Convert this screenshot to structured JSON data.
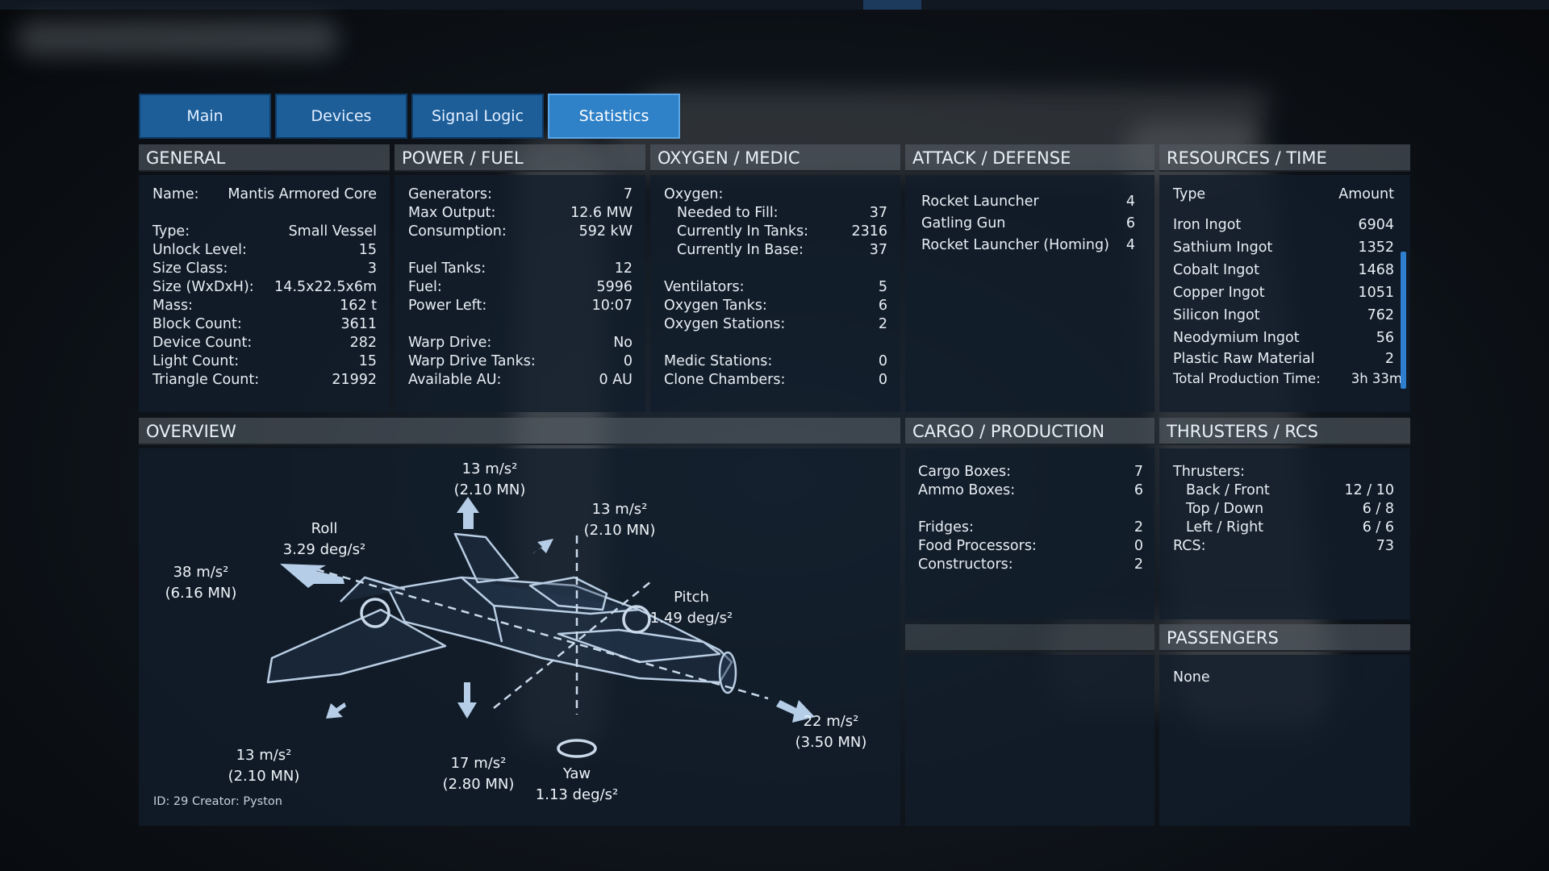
{
  "tabs": [
    {
      "label": "Main"
    },
    {
      "label": "Devices"
    },
    {
      "label": "Signal Logic"
    },
    {
      "label": "Statistics",
      "active": true
    }
  ],
  "general": {
    "title": "GENERAL",
    "rows": [
      {
        "k": "Name:",
        "v": "Mantis Armored Core"
      },
      {
        "k": "Type:",
        "v": "Small Vessel"
      },
      {
        "k": "Unlock Level:",
        "v": "15"
      },
      {
        "k": "Size Class:",
        "v": "3"
      },
      {
        "k": "Size (WxDxH):",
        "v": "14.5x22.5x6m"
      },
      {
        "k": "Mass:",
        "v": "162 t"
      },
      {
        "k": "Block Count:",
        "v": "3611"
      },
      {
        "k": "Device Count:",
        "v": "282"
      },
      {
        "k": "Light Count:",
        "v": "15"
      },
      {
        "k": "Triangle Count:",
        "v": "21992"
      }
    ]
  },
  "power": {
    "title": "POWER / FUEL",
    "rows": [
      {
        "k": "Generators:",
        "v": "7"
      },
      {
        "k": "Max Output:",
        "v": "12.6 MW"
      },
      {
        "k": "Consumption:",
        "v": "592 kW"
      },
      {
        "k": "Fuel Tanks:",
        "v": "12"
      },
      {
        "k": "Fuel:",
        "v": "5996"
      },
      {
        "k": "Power Left:",
        "v": "10:07"
      },
      {
        "k": "Warp Drive:",
        "v": "No"
      },
      {
        "k": "Warp Drive Tanks:",
        "v": "0"
      },
      {
        "k": "Available AU:",
        "v": "0 AU"
      }
    ]
  },
  "oxygen": {
    "title": "OXYGEN / MEDIC",
    "rows": [
      {
        "k": "Oxygen:",
        "v": ""
      },
      {
        "k": "Needed to Fill:",
        "v": "37"
      },
      {
        "k": "Currently In Tanks:",
        "v": "2316"
      },
      {
        "k": "Currently In Base:",
        "v": "37"
      },
      {
        "k": "Ventilators:",
        "v": "5"
      },
      {
        "k": "Oxygen Tanks:",
        "v": "6"
      },
      {
        "k": "Oxygen Stations:",
        "v": "2"
      },
      {
        "k": "Medic Stations:",
        "v": "0"
      },
      {
        "k": "Clone Chambers:",
        "v": "0"
      }
    ]
  },
  "attack": {
    "title": "ATTACK / DEFENSE",
    "rows": [
      {
        "k": "Rocket Launcher",
        "v": "4"
      },
      {
        "k": "Gatling Gun",
        "v": "6"
      },
      {
        "k": "Rocket Launcher (Homing)",
        "v": "4"
      }
    ]
  },
  "resources": {
    "title": "RESOURCES / TIME",
    "col_type": "Type",
    "col_amount": "Amount",
    "rows": [
      {
        "k": "Iron Ingot",
        "v": "6904"
      },
      {
        "k": "Sathium Ingot",
        "v": "1352"
      },
      {
        "k": "Cobalt Ingot",
        "v": "1468"
      },
      {
        "k": "Copper Ingot",
        "v": "1051"
      },
      {
        "k": "Silicon Ingot",
        "v": "762"
      },
      {
        "k": "Neodymium Ingot",
        "v": "56"
      },
      {
        "k": "Plastic Raw Material",
        "v": "2"
      }
    ],
    "total_label": "Total Production Time:",
    "total_value": "3h 33m"
  },
  "overview": {
    "title": "OVERVIEW",
    "id_creator": "ID: 29  Creator: Pyston",
    "labels": {
      "up": "13 m/s²\n(2.10 MN)",
      "fwd_up": "13 m/s²\n(2.10 MN)",
      "roll": "Roll\n3.29 deg/s²",
      "back": "38 m/s²\n(6.16 MN)",
      "pitch": "Pitch\n1.49 deg/s²",
      "forward": "22 m/s²\n(3.50 MN)",
      "left_down": "13 m/s²\n(2.10 MN)",
      "down": "17 m/s²\n(2.80 MN)",
      "yaw": "Yaw\n1.13 deg/s²"
    }
  },
  "cargo": {
    "title": "CARGO / PRODUCTION",
    "rows": [
      {
        "k": "Cargo Boxes:",
        "v": "7"
      },
      {
        "k": "Ammo Boxes:",
        "v": "6"
      },
      {
        "k": "Fridges:",
        "v": "2"
      },
      {
        "k": "Food Processors:",
        "v": "0"
      },
      {
        "k": "Constructors:",
        "v": "2"
      }
    ]
  },
  "thrusters": {
    "title": "THRUSTERS / RCS",
    "rows": [
      {
        "k": "Thrusters:",
        "v": ""
      },
      {
        "k": "Back / Front",
        "v": "12 / 10"
      },
      {
        "k": "Top / Down",
        "v": "6 / 8"
      },
      {
        "k": "Left / Right",
        "v": "6 / 6"
      },
      {
        "k": "RCS:",
        "v": "73"
      }
    ]
  },
  "passengers": {
    "title": "PASSENGERS",
    "value": "None"
  },
  "colors": {
    "tab": "#1d5e99",
    "tab_active": "#2f81c8",
    "accent": "#2f7fd0",
    "line_art": "#b9cde3"
  }
}
